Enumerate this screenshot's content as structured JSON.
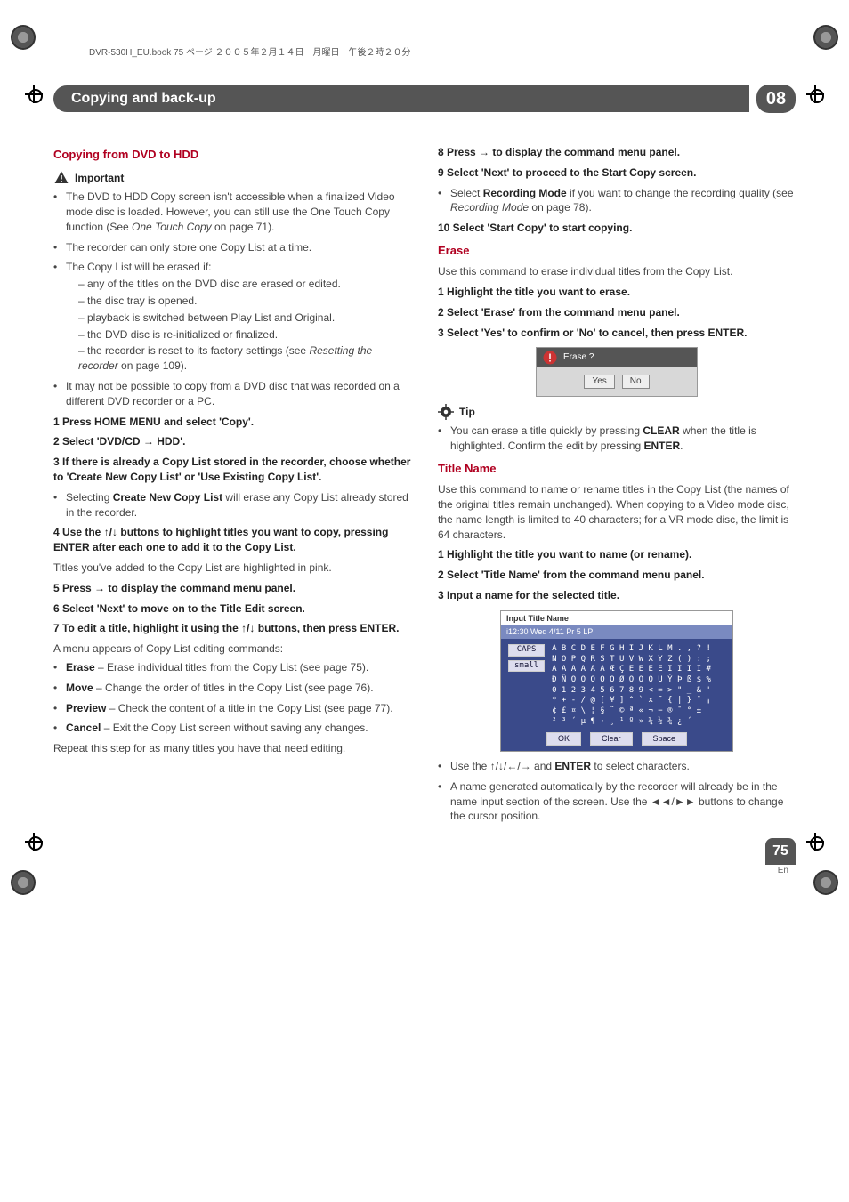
{
  "print_head": "DVR-530H_EU.book  75 ページ  ２００５年２月１４日　月曜日　午後２時２０分",
  "section_bar": {
    "title": "Copying and back-up",
    "num": "08"
  },
  "left": {
    "h_copyDvdHdd": "Copying from DVD to HDD",
    "important_label": "Important",
    "b1": "The DVD to HDD Copy screen isn't accessible when a finalized Video mode disc is loaded. However, you can still use the One Touch Copy function (See ",
    "b1_i": "One Touch Copy",
    "b1_t": " on page 71).",
    "b2": "The recorder can only store one Copy List at a time.",
    "b3": "The Copy List will be erased if:",
    "b3_s1": "– any of the titles on the DVD disc are erased or edited.",
    "b3_s2": "– the disc tray is opened.",
    "b3_s3": "– playback is switched between Play List and Original.",
    "b3_s4": "– the DVD disc is re-initialized or finalized.",
    "b3_s5a": "– the recorder is reset to its factory settings (see ",
    "b3_s5i": "Resetting the recorder",
    "b3_s5b": " on page 109).",
    "b4": "It may not be possible to copy from a DVD disc that was recorded on a different DVD recorder or a PC.",
    "s1": "1   Press HOME MENU and select 'Copy'.",
    "s2": "2   Select 'DVD/CD → HDD'.",
    "s3": "3   If there is already a Copy List stored in the recorder, choose whether to 'Create New Copy List' or 'Use Existing Copy List'.",
    "s3_ba": "Selecting ",
    "s3_bb": "Create New Copy List",
    "s3_bc": " will erase any Copy List already stored in the recorder.",
    "s4": "4   Use the ↑/↓ buttons to highlight titles you want to copy, pressing ENTER after each one to add it to the Copy List.",
    "s4_t": "Titles you've added to the Copy List are highlighted in pink.",
    "s5": "5   Press → to display the command menu panel.",
    "s6": "6   Select 'Next' to move on to the Title Edit screen.",
    "s7": "7   To edit a title, highlight it using the ↑/↓ buttons, then press ENTER.",
    "s7_t": "A menu appears of Copy List editing commands:",
    "e_erase_b": "Erase",
    "e_erase_t": " – Erase individual titles from the Copy List (see page 75).",
    "e_move_b": "Move",
    "e_move_t": " – Change the order of titles in the Copy List (see page 76).",
    "e_prev_b": "Preview",
    "e_prev_t": " – Check the content of a title in the Copy List (see page 77).",
    "e_cancel_b": "Cancel",
    "e_cancel_t": " – Exit the Copy List screen without saving any changes.",
    "repeat": "Repeat this step for as many titles you have that need editing."
  },
  "right": {
    "s8": "8   Press → to display the command menu panel.",
    "s9": "9   Select 'Next' to proceed to the Start Copy screen.",
    "s9_ba": "Select ",
    "s9_bb": "Recording Mode",
    "s9_bc": " if you want to change the recording quality (see ",
    "s9_bi": "Recording Mode",
    "s9_bd": " on page 78).",
    "s10": "10  Select 'Start Copy' to start copying.",
    "h_erase": "Erase",
    "erase_t": "Use this command to erase individual titles from the Copy List.",
    "e1": "1   Highlight the title you want to erase.",
    "e2": "2   Select 'Erase' from the command menu panel.",
    "e3": "3   Select 'Yes' to confirm or 'No' to cancel, then press ENTER.",
    "dlg": {
      "q": "Erase ?",
      "yes": "Yes",
      "no": "No"
    },
    "tip_label": "Tip",
    "tip_a": "You can erase a title quickly by pressing ",
    "tip_b": "CLEAR",
    "tip_c": " when the title is highlighted. Confirm the edit by pressing ",
    "tip_d": "ENTER",
    "tip_e": ".",
    "h_title": "Title Name",
    "title_t": "Use this command to name or rename titles in the Copy List (the names of the original titles remain unchanged). When copying to a Video mode disc, the name length is limited to 40 characters; for a VR mode disc, the limit is 64 characters.",
    "t1": "1   Highlight the title you want to name (or rename).",
    "t2": "2   Select 'Title Name' from the command menu panel.",
    "t3": "3   Input a name for the selected title.",
    "nameDlg": {
      "title": "Input Title Name",
      "bar": "i12:30 Wed  4/11  Pr 5   LP",
      "caps": "CAPS",
      "small": "small",
      "grid": "A B C D E F G H I J K L M . , ? !\nN O P Q R S T U V W X Y Z ( ) : ;\nA A A A A A Æ Ç E E E E I I I I #\nĐ Ñ O O O O O Ø O O O U Ý Þ ß $ %\n0 1 2 3 4 5 6 7 8 9 < = > \" _ & '\n* + - / @ [ ¥ ] ^ ` x ˜ { | } ¯ ¡\n¢ £ ¤ \\ ¦ § ¨ © ª « ¬ − ® ¯ ° ±\n² ³ ´ µ ¶ · ¸ ¹ º » ¼ ½ ¾ ¿ ´",
      "ok": "OK",
      "clear": "Clear",
      "space": "Space"
    },
    "foot_b1a": "Use the ↑/↓/←/→ and ",
    "foot_b1b": "ENTER",
    "foot_b1c": " to select characters.",
    "foot_b2": "A name generated automatically by the recorder will already be in the name input section of the screen. Use the ◄◄/►► buttons to change the cursor position."
  },
  "page": {
    "num": "75",
    "lang": "En"
  }
}
